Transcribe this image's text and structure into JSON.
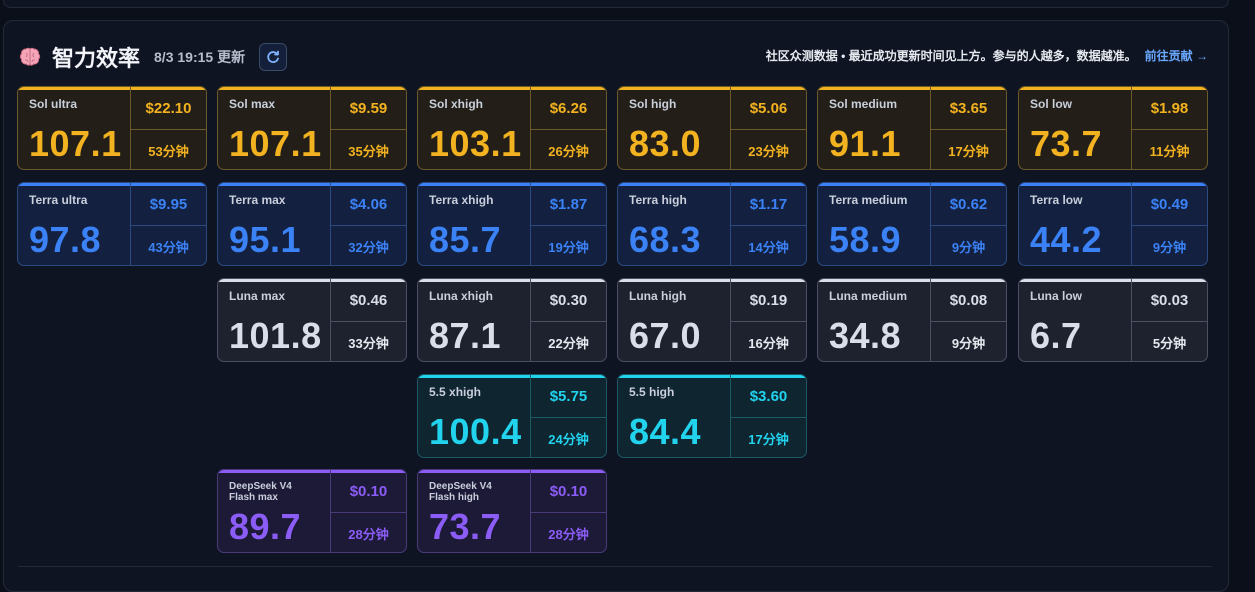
{
  "header": {
    "title": "智力效率",
    "updated": "8/3 19:15 更新",
    "notice": "社区众测数据 • 最近成功更新时间见上方。参与的人越多，数据越准。",
    "contribute": "前往贡献 →"
  },
  "cards": {
    "sol": [
      {
        "name": "Sol ultra",
        "score": "107.1",
        "price": "$22.10",
        "time": "53分钟"
      },
      {
        "name": "Sol max",
        "score": "107.1",
        "price": "$9.59",
        "time": "35分钟"
      },
      {
        "name": "Sol xhigh",
        "score": "103.1",
        "price": "$6.26",
        "time": "26分钟"
      },
      {
        "name": "Sol high",
        "score": "83.0",
        "price": "$5.06",
        "time": "23分钟"
      },
      {
        "name": "Sol medium",
        "score": "91.1",
        "price": "$3.65",
        "time": "17分钟"
      },
      {
        "name": "Sol low",
        "score": "73.7",
        "price": "$1.98",
        "time": "11分钟"
      }
    ],
    "terra": [
      {
        "name": "Terra ultra",
        "score": "97.8",
        "price": "$9.95",
        "time": "43分钟"
      },
      {
        "name": "Terra max",
        "score": "95.1",
        "price": "$4.06",
        "time": "32分钟"
      },
      {
        "name": "Terra xhigh",
        "score": "85.7",
        "price": "$1.87",
        "time": "19分钟"
      },
      {
        "name": "Terra high",
        "score": "68.3",
        "price": "$1.17",
        "time": "14分钟"
      },
      {
        "name": "Terra medium",
        "score": "58.9",
        "price": "$0.62",
        "time": "9分钟"
      },
      {
        "name": "Terra low",
        "score": "44.2",
        "price": "$0.49",
        "time": "9分钟"
      }
    ],
    "luna": [
      {
        "name": "Luna max",
        "score": "101.8",
        "price": "$0.46",
        "time": "33分钟"
      },
      {
        "name": "Luna xhigh",
        "score": "87.1",
        "price": "$0.30",
        "time": "22分钟"
      },
      {
        "name": "Luna high",
        "score": "67.0",
        "price": "$0.19",
        "time": "16分钟"
      },
      {
        "name": "Luna medium",
        "score": "34.8",
        "price": "$0.08",
        "time": "9分钟"
      },
      {
        "name": "Luna low",
        "score": "6.7",
        "price": "$0.03",
        "time": "5分钟"
      }
    ],
    "gpt55": [
      {
        "name": "5.5 xhigh",
        "score": "100.4",
        "price": "$5.75",
        "time": "24分钟"
      },
      {
        "name": "5.5 high",
        "score": "84.4",
        "price": "$3.60",
        "time": "17分钟"
      }
    ],
    "deepseek": [
      {
        "name": "DeepSeek V4 Flash max",
        "name_line1": "DeepSeek V4",
        "name_line2": "Flash max",
        "score": "89.7",
        "price": "$0.10",
        "time": "28分钟"
      },
      {
        "name": "DeepSeek V4 Flash high",
        "name_line1": "DeepSeek V4",
        "name_line2": "Flash high",
        "score": "73.7",
        "price": "$0.10",
        "time": "28分钟"
      }
    ]
  },
  "colors": {
    "sol": "#f3b21f",
    "terra": "#3b82f6",
    "luna": "#d9dee8",
    "gpt55": "#22d3ee",
    "deepseek": "#8b5cf6",
    "contribute_link": "#6aa8ff"
  },
  "icons": {
    "title": "brain-icon",
    "refresh": "refresh-icon"
  }
}
